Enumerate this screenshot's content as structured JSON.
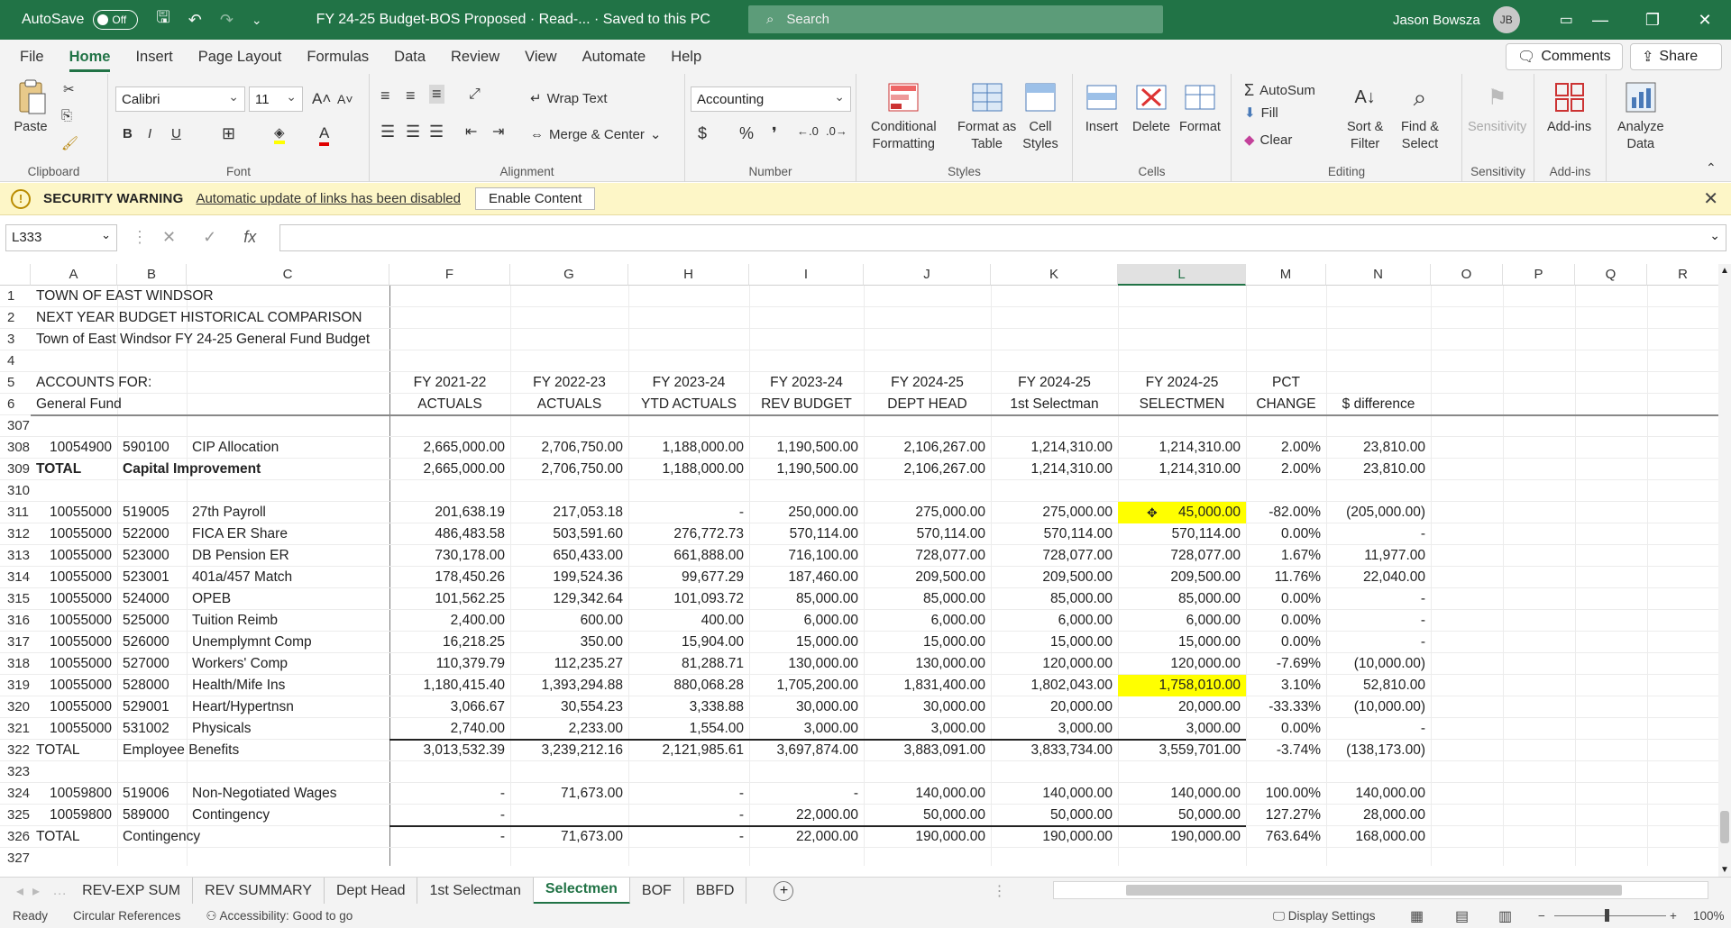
{
  "titlebar": {
    "autosave_label": "AutoSave",
    "autosave_state": "Off",
    "doc_title": "FY 24-25 Budget-BOS Proposed  ·  Read-...  ·  Saved to this PC",
    "search_placeholder": "Search",
    "user_name": "Jason Bowsza",
    "user_initials": "JB"
  },
  "ribbon_tabs": [
    "File",
    "Home",
    "Insert",
    "Page Layout",
    "Formulas",
    "Data",
    "Review",
    "View",
    "Automate",
    "Help"
  ],
  "ribbon_actions": {
    "comments": "Comments",
    "share": "Share"
  },
  "ribbon": {
    "clipboard": {
      "paste": "Paste",
      "label": "Clipboard"
    },
    "font": {
      "name": "Calibri",
      "size": "11",
      "label": "Font"
    },
    "alignment": {
      "wrap": "Wrap Text",
      "merge": "Merge & Center",
      "label": "Alignment"
    },
    "number": {
      "format": "Accounting",
      "label": "Number"
    },
    "styles": {
      "cond1": "Conditional",
      "cond2": "Formatting",
      "table1": "Format as",
      "table2": "Table",
      "cell1": "Cell",
      "cell2": "Styles",
      "label": "Styles"
    },
    "cells": {
      "insert": "Insert",
      "delete": "Delete",
      "format": "Format",
      "label": "Cells"
    },
    "editing": {
      "autosum": "AutoSum",
      "fill": "Fill",
      "clear": "Clear",
      "sort1": "Sort &",
      "sort2": "Filter",
      "find1": "Find &",
      "find2": "Select",
      "label": "Editing"
    },
    "sensitivity": {
      "btn": "Sensitivity",
      "label": "Sensitivity"
    },
    "addins": {
      "btn": "Add-ins",
      "label": "Add-ins"
    },
    "analyze": {
      "btn1": "Analyze",
      "btn2": "Data"
    }
  },
  "security": {
    "title": "SECURITY WARNING",
    "message": "Automatic update of links has been disabled",
    "button": "Enable Content"
  },
  "formula_bar": {
    "name_box": "L333",
    "fx": "fx",
    "formula": ""
  },
  "columns": [
    "A",
    "B",
    "C",
    "F",
    "G",
    "H",
    "I",
    "J",
    "K",
    "L",
    "M",
    "N",
    "O",
    "P",
    "Q",
    "R"
  ],
  "rows": [
    {
      "num": "1",
      "A": "TOWN OF EAST WINDSOR"
    },
    {
      "num": "2",
      "A": "NEXT YEAR BUDGET HISTORICAL COMPARISON"
    },
    {
      "num": "3",
      "A": "Town of East Windsor FY 24-25 General Fund Budget"
    },
    {
      "num": "4"
    },
    {
      "num": "5",
      "A": "ACCOUNTS FOR:",
      "F": "FY 2021-22",
      "G": "FY 2022-23",
      "H": "FY 2023-24",
      "I": "FY 2023-24",
      "J": "FY 2024-25",
      "K": "FY 2024-25",
      "L": "FY 2024-25",
      "M": "PCT"
    },
    {
      "num": "6",
      "A": "General Fund",
      "F": "ACTUALS",
      "G": "ACTUALS",
      "H": "YTD ACTUALS",
      "I": "REV BUDGET",
      "J": "DEPT HEAD",
      "K": "1st Selectman",
      "L": "SELECTMEN",
      "M": "CHANGE",
      "N": "$ difference"
    },
    {
      "num": "307"
    },
    {
      "num": "308",
      "A": "10054900",
      "B": "590100",
      "C": "CIP Allocation",
      "F": "2,665,000.00",
      "G": "2,706,750.00",
      "H": "1,188,000.00",
      "I": "1,190,500.00",
      "J": "2,106,267.00",
      "K": "1,214,310.00",
      "L": "1,214,310.00",
      "M": "2.00%",
      "N": "23,810.00"
    },
    {
      "num": "309",
      "A": "TOTAL",
      "B": "Capital Improvement",
      "F": "2,665,000.00",
      "G": "2,706,750.00",
      "H": "1,188,000.00",
      "I": "1,190,500.00",
      "J": "2,106,267.00",
      "K": "1,214,310.00",
      "L": "1,214,310.00",
      "M": "2.00%",
      "N": "23,810.00",
      "bold": true
    },
    {
      "num": "310"
    },
    {
      "num": "311",
      "A": "10055000",
      "B": "519005",
      "C": "27th Payroll",
      "F": "201,638.19",
      "G": "217,053.18",
      "H": "-",
      "I": "250,000.00",
      "J": "275,000.00",
      "K": "275,000.00",
      "L": "45,000.00",
      "M": "-82.00%",
      "N": "(205,000.00)",
      "hlL": true
    },
    {
      "num": "312",
      "A": "10055000",
      "B": "522000",
      "C": "FICA ER Share",
      "F": "486,483.58",
      "G": "503,591.60",
      "H": "276,772.73",
      "I": "570,114.00",
      "J": "570,114.00",
      "K": "570,114.00",
      "L": "570,114.00",
      "M": "0.00%",
      "N": "-"
    },
    {
      "num": "313",
      "A": "10055000",
      "B": "523000",
      "C": "DB Pension ER",
      "F": "730,178.00",
      "G": "650,433.00",
      "H": "661,888.00",
      "I": "716,100.00",
      "J": "728,077.00",
      "K": "728,077.00",
      "L": "728,077.00",
      "M": "1.67%",
      "N": "11,977.00"
    },
    {
      "num": "314",
      "A": "10055000",
      "B": "523001",
      "C": "401a/457 Match",
      "F": "178,450.26",
      "G": "199,524.36",
      "H": "99,677.29",
      "I": "187,460.00",
      "J": "209,500.00",
      "K": "209,500.00",
      "L": "209,500.00",
      "M": "11.76%",
      "N": "22,040.00"
    },
    {
      "num": "315",
      "A": "10055000",
      "B": "524000",
      "C": "OPEB",
      "F": "101,562.25",
      "G": "129,342.64",
      "H": "101,093.72",
      "I": "85,000.00",
      "J": "85,000.00",
      "K": "85,000.00",
      "L": "85,000.00",
      "M": "0.00%",
      "N": "-"
    },
    {
      "num": "316",
      "A": "10055000",
      "B": "525000",
      "C": "Tuition Reimb",
      "F": "2,400.00",
      "G": "600.00",
      "H": "400.00",
      "I": "6,000.00",
      "J": "6,000.00",
      "K": "6,000.00",
      "L": "6,000.00",
      "M": "0.00%",
      "N": "-"
    },
    {
      "num": "317",
      "A": "10055000",
      "B": "526000",
      "C": "Unemplymnt Comp",
      "F": "16,218.25",
      "G": "350.00",
      "H": "15,904.00",
      "I": "15,000.00",
      "J": "15,000.00",
      "K": "15,000.00",
      "L": "15,000.00",
      "M": "0.00%",
      "N": "-"
    },
    {
      "num": "318",
      "A": "10055000",
      "B": "527000",
      "C": "Workers' Comp",
      "F": "110,379.79",
      "G": "112,235.27",
      "H": "81,288.71",
      "I": "130,000.00",
      "J": "130,000.00",
      "K": "120,000.00",
      "L": "120,000.00",
      "M": "-7.69%",
      "N": "(10,000.00)"
    },
    {
      "num": "319",
      "A": "10055000",
      "B": "528000",
      "C": "Health/Mife Ins",
      "F": "1,180,415.40",
      "G": "1,393,294.88",
      "H": "880,068.28",
      "I": "1,705,200.00",
      "J": "1,831,400.00",
      "K": "1,802,043.00",
      "L": "1,758,010.00",
      "M": "3.10%",
      "N": "52,810.00",
      "hlL": true
    },
    {
      "num": "320",
      "A": "10055000",
      "B": "529001",
      "C": "Heart/Hypertnsn",
      "F": "3,066.67",
      "G": "30,554.23",
      "H": "3,338.88",
      "I": "30,000.00",
      "J": "30,000.00",
      "K": "20,000.00",
      "L": "20,000.00",
      "M": "-33.33%",
      "N": "(10,000.00)"
    },
    {
      "num": "321",
      "A": "10055000",
      "B": "531002",
      "C": "Physicals",
      "F": "2,740.00",
      "G": "2,233.00",
      "H": "1,554.00",
      "I": "3,000.00",
      "J": "3,000.00",
      "K": "3,000.00",
      "L": "3,000.00",
      "M": "0.00%",
      "N": "-"
    },
    {
      "num": "322",
      "A": "TOTAL",
      "B": "Employee Benefits",
      "F": "3,013,532.39",
      "G": "3,239,212.16",
      "H": "2,121,985.61",
      "I": "3,697,874.00",
      "J": "3,883,091.00",
      "K": "3,833,734.00",
      "L": "3,559,701.00",
      "M": "-3.74%",
      "N": "(138,173.00)"
    },
    {
      "num": "323"
    },
    {
      "num": "324",
      "A": "10059800",
      "B": "519006",
      "C": "Non-Negotiated Wages",
      "F": "-",
      "G": "71,673.00",
      "H": "-",
      "I": "-",
      "J": "140,000.00",
      "K": "140,000.00",
      "L": "140,000.00",
      "M": "100.00%",
      "N": "140,000.00"
    },
    {
      "num": "325",
      "A": "10059800",
      "B": "589000",
      "C": "Contingency",
      "F": "-",
      "G": "",
      "H": "-",
      "I": "22,000.00",
      "J": "50,000.00",
      "K": "50,000.00",
      "L": "50,000.00",
      "M": "127.27%",
      "N": "28,000.00"
    },
    {
      "num": "326",
      "A": "TOTAL",
      "B": "Contingency",
      "F": "-",
      "G": "71,673.00",
      "H": "-",
      "I": "22,000.00",
      "J": "190,000.00",
      "K": "190,000.00",
      "L": "190,000.00",
      "M": "763.64%",
      "N": "168,000.00"
    },
    {
      "num": "327"
    }
  ],
  "sheet_tabs": [
    "REV-EXP SUM",
    "REV SUMMARY",
    "Dept Head",
    "1st Selectman",
    "Selectmen",
    "BOF",
    "BBFD"
  ],
  "active_sheet": "Selectmen",
  "status": {
    "ready": "Ready",
    "circular": "Circular References",
    "accessibility": "Accessibility: Good to go",
    "display": "Display Settings",
    "zoom": "100%"
  },
  "colors": {
    "excel_green": "#217346",
    "highlight": "#ffff00",
    "warning_bg": "#fdf6c7"
  }
}
